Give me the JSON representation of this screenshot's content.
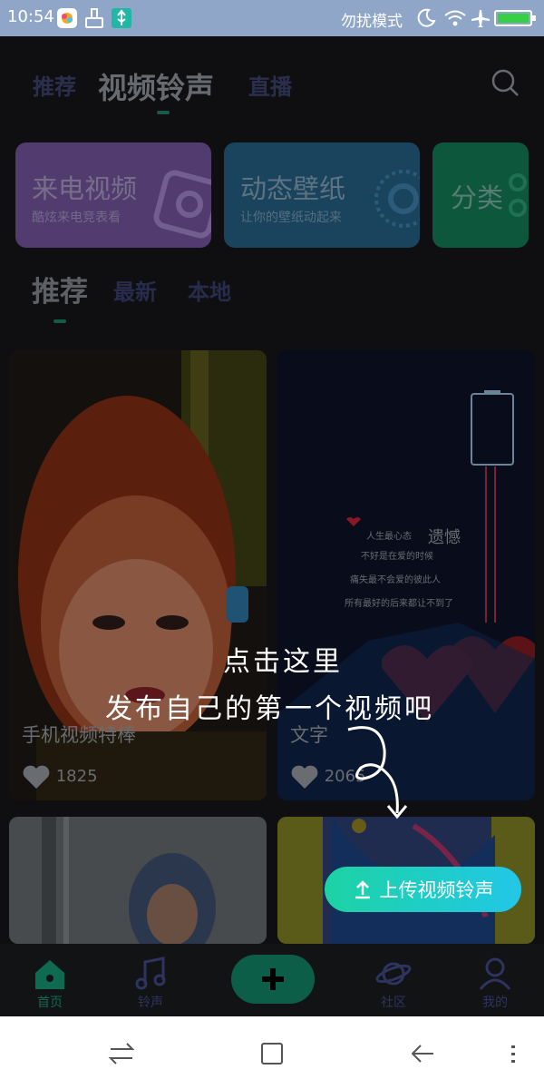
{
  "status_bar": {
    "time": "10:54",
    "dnd_text": "勿扰模式"
  },
  "top_tabs": [
    {
      "label": "推荐",
      "active": false
    },
    {
      "label": "视频铃声",
      "active": true
    },
    {
      "label": "直播",
      "active": false
    }
  ],
  "category_cards": [
    {
      "title": "来电视频",
      "subtitle": "酷炫来电竞表看",
      "color": "#8b5fbf"
    },
    {
      "title": "动态壁纸",
      "subtitle": "让你的壁纸动起来",
      "color": "#2a6f9e"
    },
    {
      "title": "分类",
      "subtitle": "",
      "color": "#15835f"
    }
  ],
  "sub_tabs": [
    {
      "label": "推荐",
      "active": true
    },
    {
      "label": "最新",
      "active": false
    },
    {
      "label": "本地",
      "active": false
    }
  ],
  "videos": [
    {
      "title": "手机视频特棒",
      "likes": "1825"
    },
    {
      "title": "文字",
      "likes": "2065"
    }
  ],
  "video_poster_text": {
    "heading": "遗憾",
    "lines": [
      "人生最心态",
      "不好是在爱的时候",
      "痛失最不会爱的彼此人",
      "所有最好的后来都让不到了"
    ]
  },
  "guide": {
    "line1": "点击这里",
    "line2": "发布自己的第一个视频吧"
  },
  "upload_button": {
    "label": "上传视频铃声"
  },
  "bottom_nav": [
    {
      "label": "首页",
      "active": true
    },
    {
      "label": "铃声",
      "active": false
    },
    {
      "label": "社区",
      "active": false
    },
    {
      "label": "我的",
      "active": false
    }
  ],
  "colors": {
    "accent": "#1cd3a4",
    "accent_end": "#22c7e7",
    "status_bar": "#8fa6c8"
  }
}
